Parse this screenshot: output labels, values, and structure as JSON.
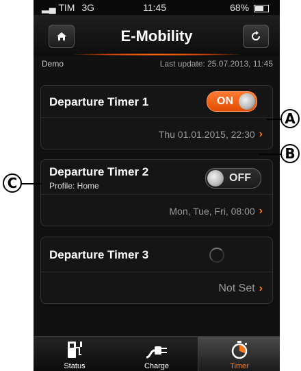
{
  "statusbar": {
    "carrier": "TIM",
    "network": "3G",
    "time": "11:45",
    "battery": "68%"
  },
  "nav": {
    "title": "E-Mobility",
    "home_icon": "home-icon",
    "refresh_icon": "refresh-icon"
  },
  "subbar": {
    "mode": "Demo",
    "last_update": "Last update: 25.07.2013, 11:45"
  },
  "timers": [
    {
      "title": "Departure Timer 1",
      "state": "ON",
      "profile": "",
      "schedule": "Thu 01.01.2015, 22:30"
    },
    {
      "title": "Departure Timer 2",
      "state": "OFF",
      "profile": "Profile: Home",
      "schedule": "Mon, Tue, Fri, 08:00"
    },
    {
      "title": "Departure Timer 3",
      "state": "",
      "profile": "",
      "schedule": "Not Set"
    }
  ],
  "tabs": [
    {
      "label": "Status",
      "icon": "charging-station-icon"
    },
    {
      "label": "Charge",
      "icon": "plug-icon"
    },
    {
      "label": "Timer",
      "icon": "stopwatch-icon"
    }
  ],
  "callouts": {
    "a": "A",
    "b": "B",
    "c": "C"
  },
  "colors": {
    "accent": "#ff7a1a",
    "background": "#111111"
  }
}
